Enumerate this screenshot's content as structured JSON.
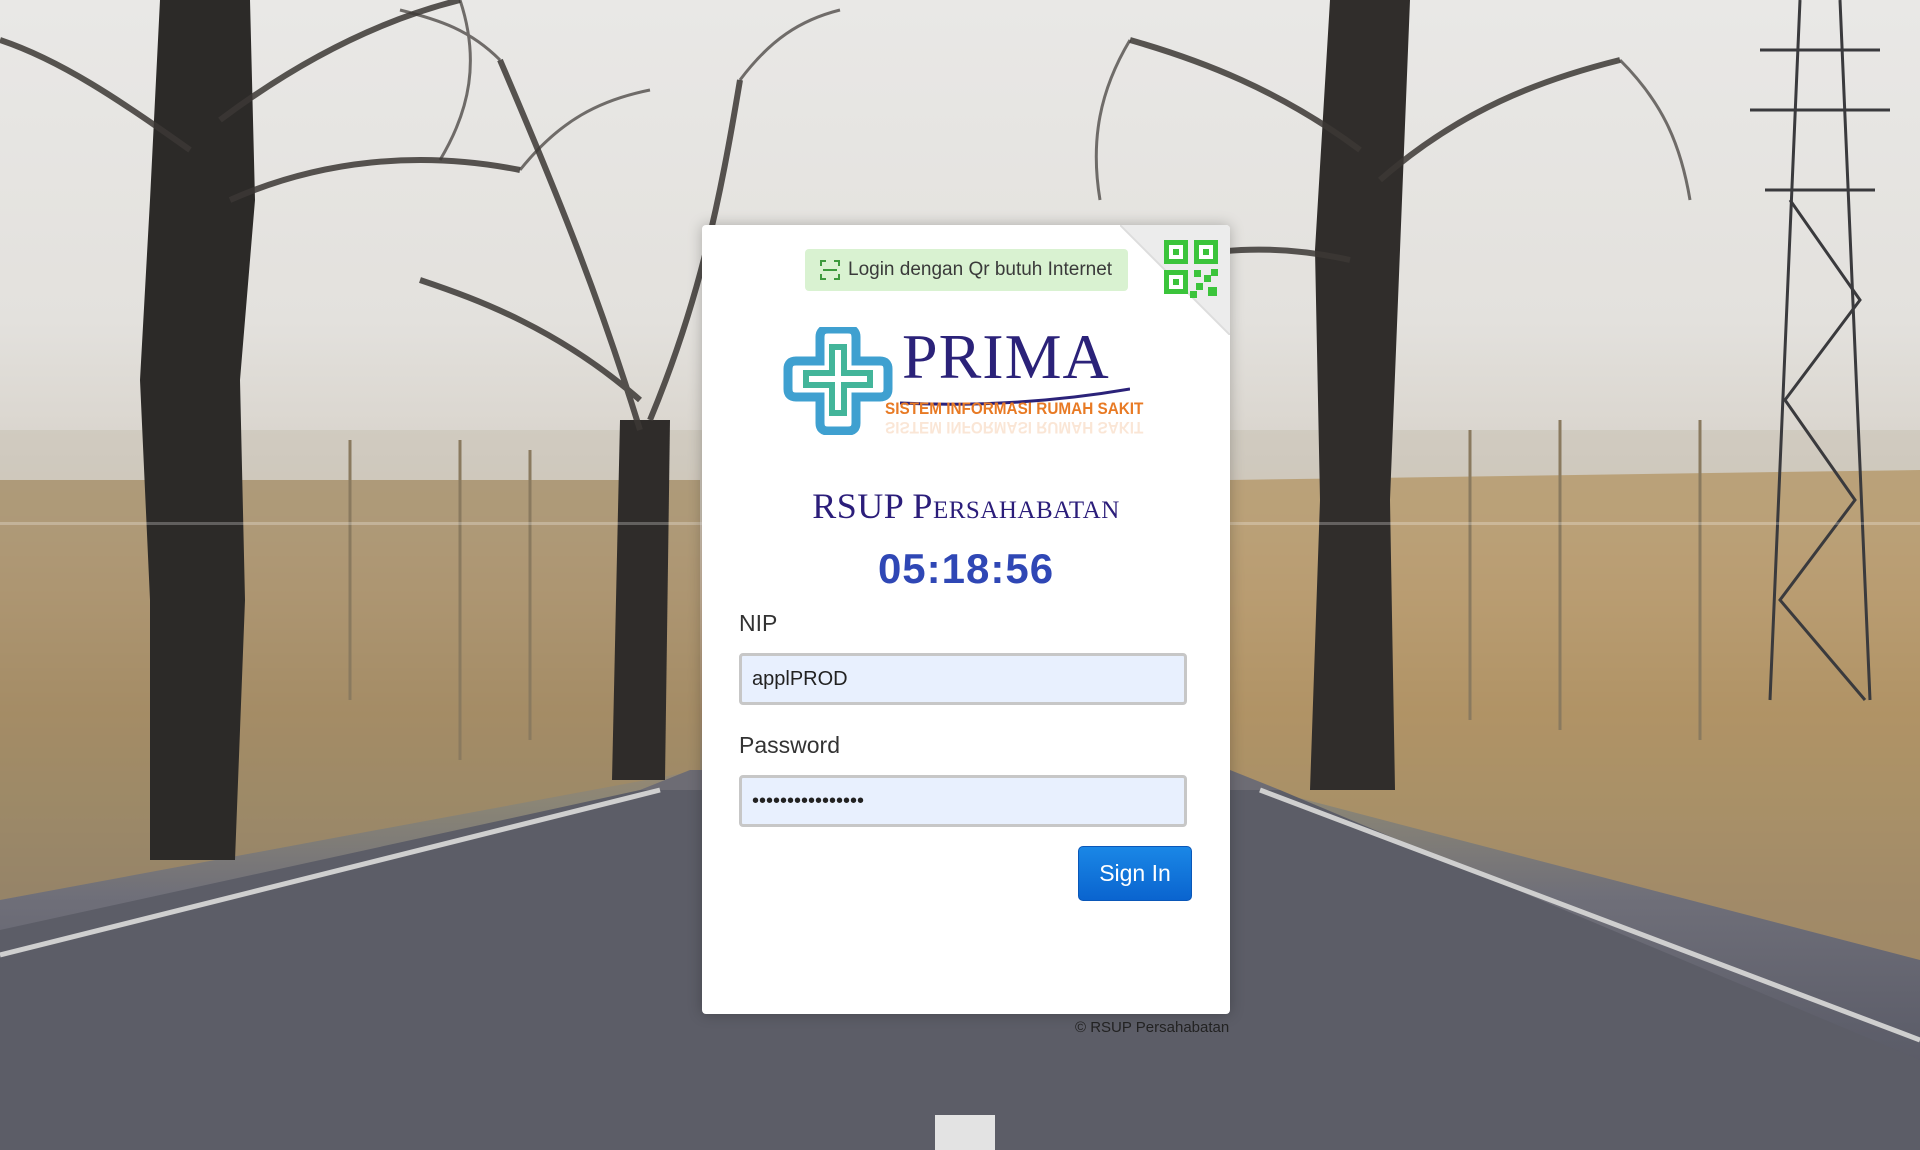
{
  "qr_login": {
    "label": "Login dengan Qr butuh Internet"
  },
  "logo": {
    "title": "PRIMA",
    "subtitle": "SISTEM INFORMASI RUMAH SAKIT"
  },
  "hospital_name": "RSUP Persahabatan",
  "clock": "05:18:56",
  "form": {
    "nip_label": "NIP",
    "nip_value": "applPROD",
    "password_label": "Password",
    "password_value": "••••••••••••••••",
    "signin_label": "Sign In"
  },
  "footer": "© RSUP Persahabatan",
  "colors": {
    "brand_navy": "#2b2279",
    "brand_orange": "#e87a24",
    "qr_green": "#3bc43b",
    "clock_blue": "#2f47b5",
    "button_blue": "#0a64cf"
  }
}
